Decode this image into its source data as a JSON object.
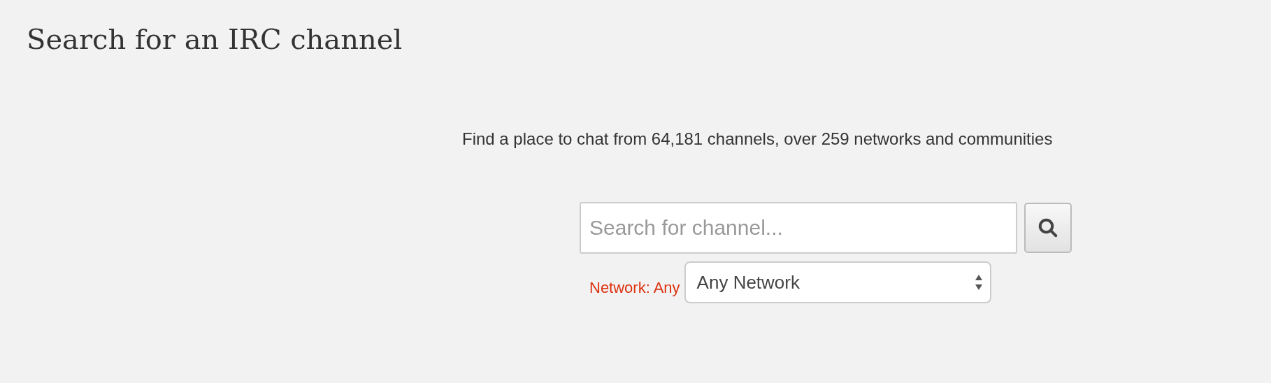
{
  "title": "Search for an IRC channel",
  "subtitle": "Find a place to chat from 64,181 channels, over 259 networks and communities",
  "search": {
    "placeholder": "Search for channel..."
  },
  "network": {
    "label": "Network: Any",
    "value": "Any Network"
  }
}
